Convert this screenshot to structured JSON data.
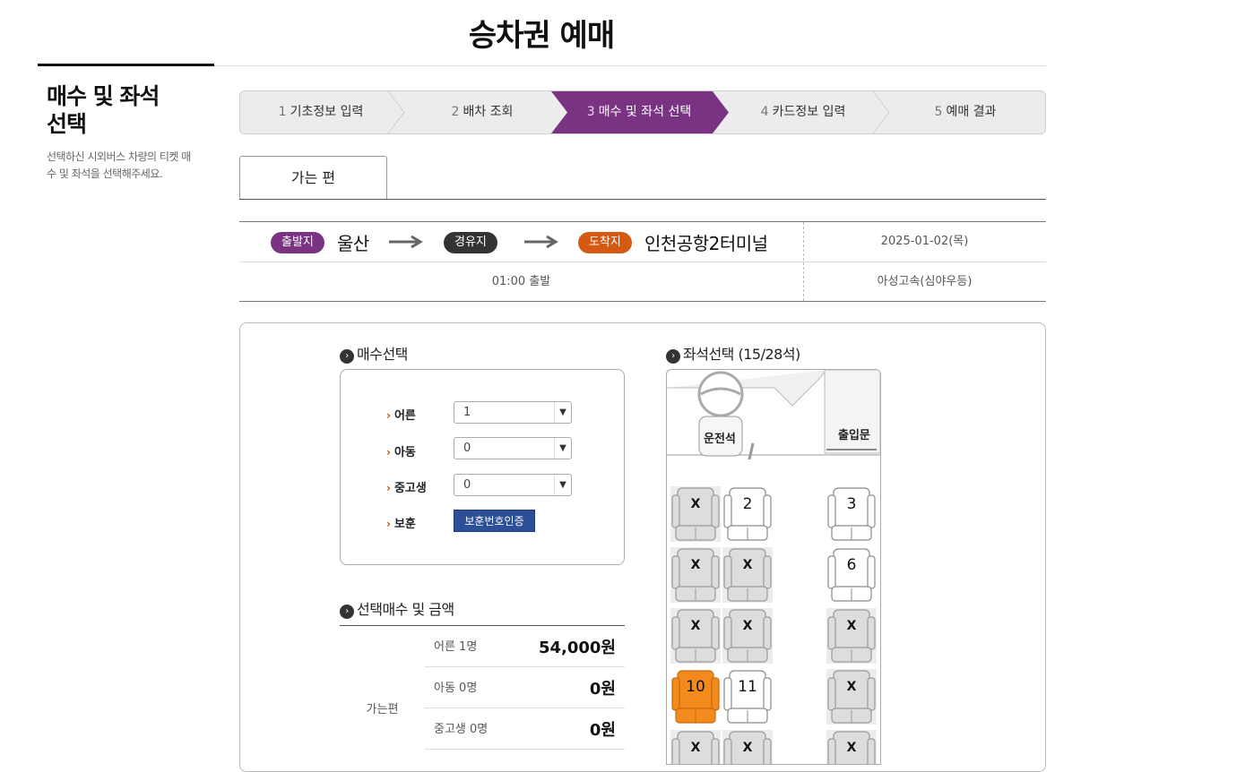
{
  "page_title": "승차권 예매",
  "sidebar": {
    "title_line1": "매수 및 좌석",
    "title_line2": "선택",
    "desc_line1": "선택하신 시외버스 차량의 티켓 매",
    "desc_line2": "수 및 좌석을 선택해주세요."
  },
  "steps": [
    {
      "num": "1",
      "label": "기초정보 입력"
    },
    {
      "num": "2",
      "label": "배차 조회"
    },
    {
      "num": "3",
      "label": "매수 및 좌석 선택",
      "active": true
    },
    {
      "num": "4",
      "label": "카드정보 입력"
    },
    {
      "num": "5",
      "label": "예매 결과"
    }
  ],
  "tab": {
    "label": "가는 편"
  },
  "route": {
    "depart_badge": "출발지",
    "depart_city": "울산",
    "via_badge": "경유지",
    "arrive_badge": "도착지",
    "arrive_city": "인천공항2터미널",
    "date": "2025-01-02(목)",
    "time": "01:00 출발",
    "company": "아성고속(심야우등)"
  },
  "colors": {
    "accent_purple": "#7a3383",
    "accent_orange": "#d45a12",
    "via_dark": "#333333",
    "selected_seat": "#f28a1e",
    "verify_button": "#2c4f97"
  },
  "quantity": {
    "title": "매수선택",
    "adult_label": "어른",
    "adult_value": "1",
    "child_label": "아동",
    "child_value": "0",
    "teen_label": "중고생",
    "teen_value": "0",
    "veteran_label": "보훈",
    "veteran_button": "보훈번호인증"
  },
  "price": {
    "title": "선택매수 및 금액",
    "direction": "가는편",
    "rows": [
      {
        "label": "어른 1명",
        "value": "54,000원"
      },
      {
        "label": "아동 0명",
        "value": "0원"
      },
      {
        "label": "중고생 0명",
        "value": "0원"
      }
    ]
  },
  "seats": {
    "title": "좌석선택 (15/28석)",
    "driver_label": "운전석",
    "door_label": "출입문",
    "occupied_mark": "X",
    "list": [
      {
        "id": "1",
        "status": "occupied"
      },
      {
        "id": "2",
        "status": "available"
      },
      {
        "id": "3",
        "status": "available"
      },
      {
        "id": "4",
        "status": "occupied"
      },
      {
        "id": "5",
        "status": "occupied"
      },
      {
        "id": "6",
        "status": "available"
      },
      {
        "id": "7",
        "status": "occupied"
      },
      {
        "id": "8",
        "status": "occupied"
      },
      {
        "id": "9",
        "status": "occupied"
      },
      {
        "id": "10",
        "status": "selected"
      },
      {
        "id": "11",
        "status": "available"
      },
      {
        "id": "12",
        "status": "occupied"
      },
      {
        "id": "13",
        "status": "occupied"
      },
      {
        "id": "14",
        "status": "occupied"
      },
      {
        "id": "15",
        "status": "occupied"
      }
    ]
  }
}
